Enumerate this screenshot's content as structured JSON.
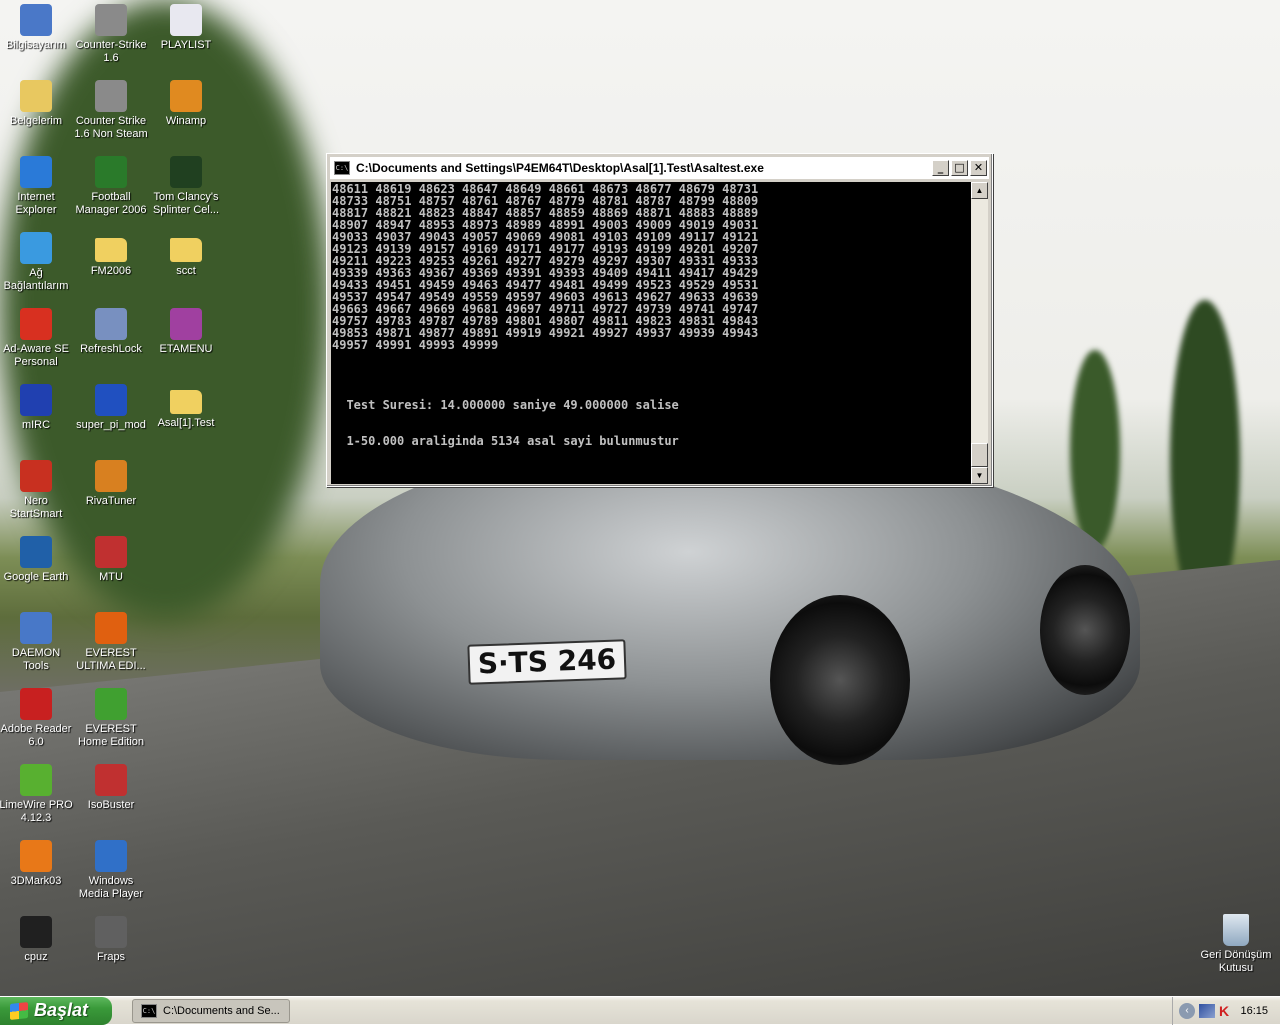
{
  "desktop": {
    "icons": [
      {
        "label": "Bilgisayarım",
        "icon": "my-computer-icon",
        "color": "#4a78c8",
        "col": 0,
        "row": 0
      },
      {
        "label": "Belgelerim",
        "icon": "my-documents-icon",
        "color": "#e8c860",
        "col": 0,
        "row": 1
      },
      {
        "label": "Internet Explorer",
        "icon": "internet-explorer-icon",
        "color": "#2a7ad8",
        "col": 0,
        "row": 2
      },
      {
        "label": "Ağ Bağlantılarım",
        "icon": "network-connections-icon",
        "color": "#3a9ae0",
        "col": 0,
        "row": 3
      },
      {
        "label": "Ad-Aware SE Personal",
        "icon": "ad-aware-icon",
        "color": "#d83020",
        "col": 0,
        "row": 4
      },
      {
        "label": "mIRC",
        "icon": "mirc-icon",
        "color": "#2040b0",
        "col": 0,
        "row": 5
      },
      {
        "label": "Nero StartSmart",
        "icon": "nero-icon",
        "color": "#c83020",
        "col": 0,
        "row": 6
      },
      {
        "label": "Google Earth",
        "icon": "google-earth-icon",
        "color": "#2060a8",
        "col": 0,
        "row": 7
      },
      {
        "label": "DAEMON Tools",
        "icon": "daemon-tools-icon",
        "color": "#4878c8",
        "col": 0,
        "row": 8
      },
      {
        "label": "Adobe Reader 6.0",
        "icon": "adobe-reader-icon",
        "color": "#c82020",
        "col": 0,
        "row": 9
      },
      {
        "label": "LimeWire PRO 4.12.3",
        "icon": "limewire-icon",
        "color": "#58b030",
        "col": 0,
        "row": 10
      },
      {
        "label": "3DMark03",
        "icon": "3dmark-icon",
        "color": "#e87818",
        "col": 0,
        "row": 11
      },
      {
        "label": "cpuz",
        "icon": "cpu-chip-icon",
        "color": "#202020",
        "col": 0,
        "row": 12
      },
      {
        "label": "Counter-Strike 1.6",
        "icon": "counter-strike-icon",
        "color": "#8a8a8a",
        "col": 1,
        "row": 0
      },
      {
        "label": "Counter Strike 1.6 Non Steam",
        "icon": "counter-strike-icon",
        "color": "#8a8a8a",
        "col": 1,
        "row": 1
      },
      {
        "label": "Football Manager 2006",
        "icon": "football-manager-icon",
        "color": "#2a7a2a",
        "col": 1,
        "row": 2
      },
      {
        "label": "FM2006",
        "icon": "folder-icon",
        "color": "#f0d060",
        "col": 1,
        "row": 3
      },
      {
        "label": "RefreshLock",
        "icon": "refreshlock-icon",
        "color": "#7890c0",
        "col": 1,
        "row": 4
      },
      {
        "label": "super_pi_mod",
        "icon": "super-pi-icon",
        "color": "#2050c0",
        "col": 1,
        "row": 5
      },
      {
        "label": "RivaTuner",
        "icon": "rivatuner-icon",
        "color": "#d88020",
        "col": 1,
        "row": 6
      },
      {
        "label": "MTU",
        "icon": "mtu-icon",
        "color": "#c03030",
        "col": 1,
        "row": 7
      },
      {
        "label": "EVEREST ULTIMA EDI...",
        "icon": "everest-ultimate-icon",
        "color": "#e06010",
        "col": 1,
        "row": 8
      },
      {
        "label": "EVEREST Home Edition",
        "icon": "everest-home-icon",
        "color": "#40a030",
        "col": 1,
        "row": 9
      },
      {
        "label": "IsoBuster",
        "icon": "isobuster-icon",
        "color": "#c03030",
        "col": 1,
        "row": 10
      },
      {
        "label": "Windows Media Player",
        "icon": "media-player-icon",
        "color": "#3070c8",
        "col": 1,
        "row": 11
      },
      {
        "label": "Fraps",
        "icon": "fraps-icon",
        "color": "#606060",
        "col": 1,
        "row": 12
      },
      {
        "label": "PLAYLIST",
        "icon": "playlist-file-icon",
        "color": "#e8e8f0",
        "col": 2,
        "row": 0
      },
      {
        "label": "Winamp",
        "icon": "winamp-icon",
        "color": "#e08a20",
        "col": 2,
        "row": 1
      },
      {
        "label": "Tom Clancy's Splinter Cel...",
        "icon": "splinter-cell-icon",
        "color": "#204020",
        "col": 2,
        "row": 2
      },
      {
        "label": "scct",
        "icon": "folder-icon",
        "color": "#f0d060",
        "col": 2,
        "row": 3
      },
      {
        "label": "ETAMENU",
        "icon": "etamenu-icon",
        "color": "#a040a0",
        "col": 2,
        "row": 4
      },
      {
        "label": "Asal[1].Test",
        "icon": "folder-icon",
        "color": "#f0d060",
        "col": 2,
        "row": 5
      }
    ],
    "recycle_bin": {
      "label": "Geri Dönüşüm Kutusu",
      "icon": "recycle-bin-icon"
    },
    "wallpaper_plate": "S·TS 246"
  },
  "console_window": {
    "title": "C:\\Documents and Settings\\P4EM64T\\Desktop\\Asal[1].Test\\Asaltest.exe",
    "icon": "console-icon",
    "buttons": {
      "minimize": "_",
      "maximize": "□",
      "close": "✕"
    },
    "lines": [
      "48611 48619 48623 48647 48649 48661 48673 48677 48679 48731",
      "48733 48751 48757 48761 48767 48779 48781 48787 48799 48809",
      "48817 48821 48823 48847 48857 48859 48869 48871 48883 48889",
      "48907 48947 48953 48973 48989 48991 49003 49009 49019 49031",
      "49033 49037 49043 49057 49069 49081 49103 49109 49117 49121",
      "49123 49139 49157 49169 49171 49177 49193 49199 49201 49207",
      "49211 49223 49253 49261 49277 49279 49297 49307 49331 49333",
      "49339 49363 49367 49369 49391 49393 49409 49411 49417 49429",
      "49433 49451 49459 49463 49477 49481 49499 49523 49529 49531",
      "49537 49547 49549 49559 49597 49603 49613 49627 49633 49639",
      "49663 49667 49669 49681 49697 49711 49727 49739 49741 49747",
      "49757 49783 49787 49789 49801 49807 49811 49823 49831 49843",
      "49853 49871 49877 49891 49919 49921 49927 49937 49939 49943",
      "49957 49991 49993 49999",
      "",
      "",
      "",
      "",
      "  Test Suresi: 14.000000 saniye 49.000000 salise",
      "",
      "",
      "  1-50.000 araliginda 5134 asal sayi bulunmustur"
    ]
  },
  "taskbar": {
    "start_label": "Başlat",
    "task_label": "C:\\Documents and Se...",
    "tray_icons": [
      "show-hidden-icons-icon",
      "network-icon",
      "kaspersky-icon"
    ],
    "clock": "16:15"
  }
}
